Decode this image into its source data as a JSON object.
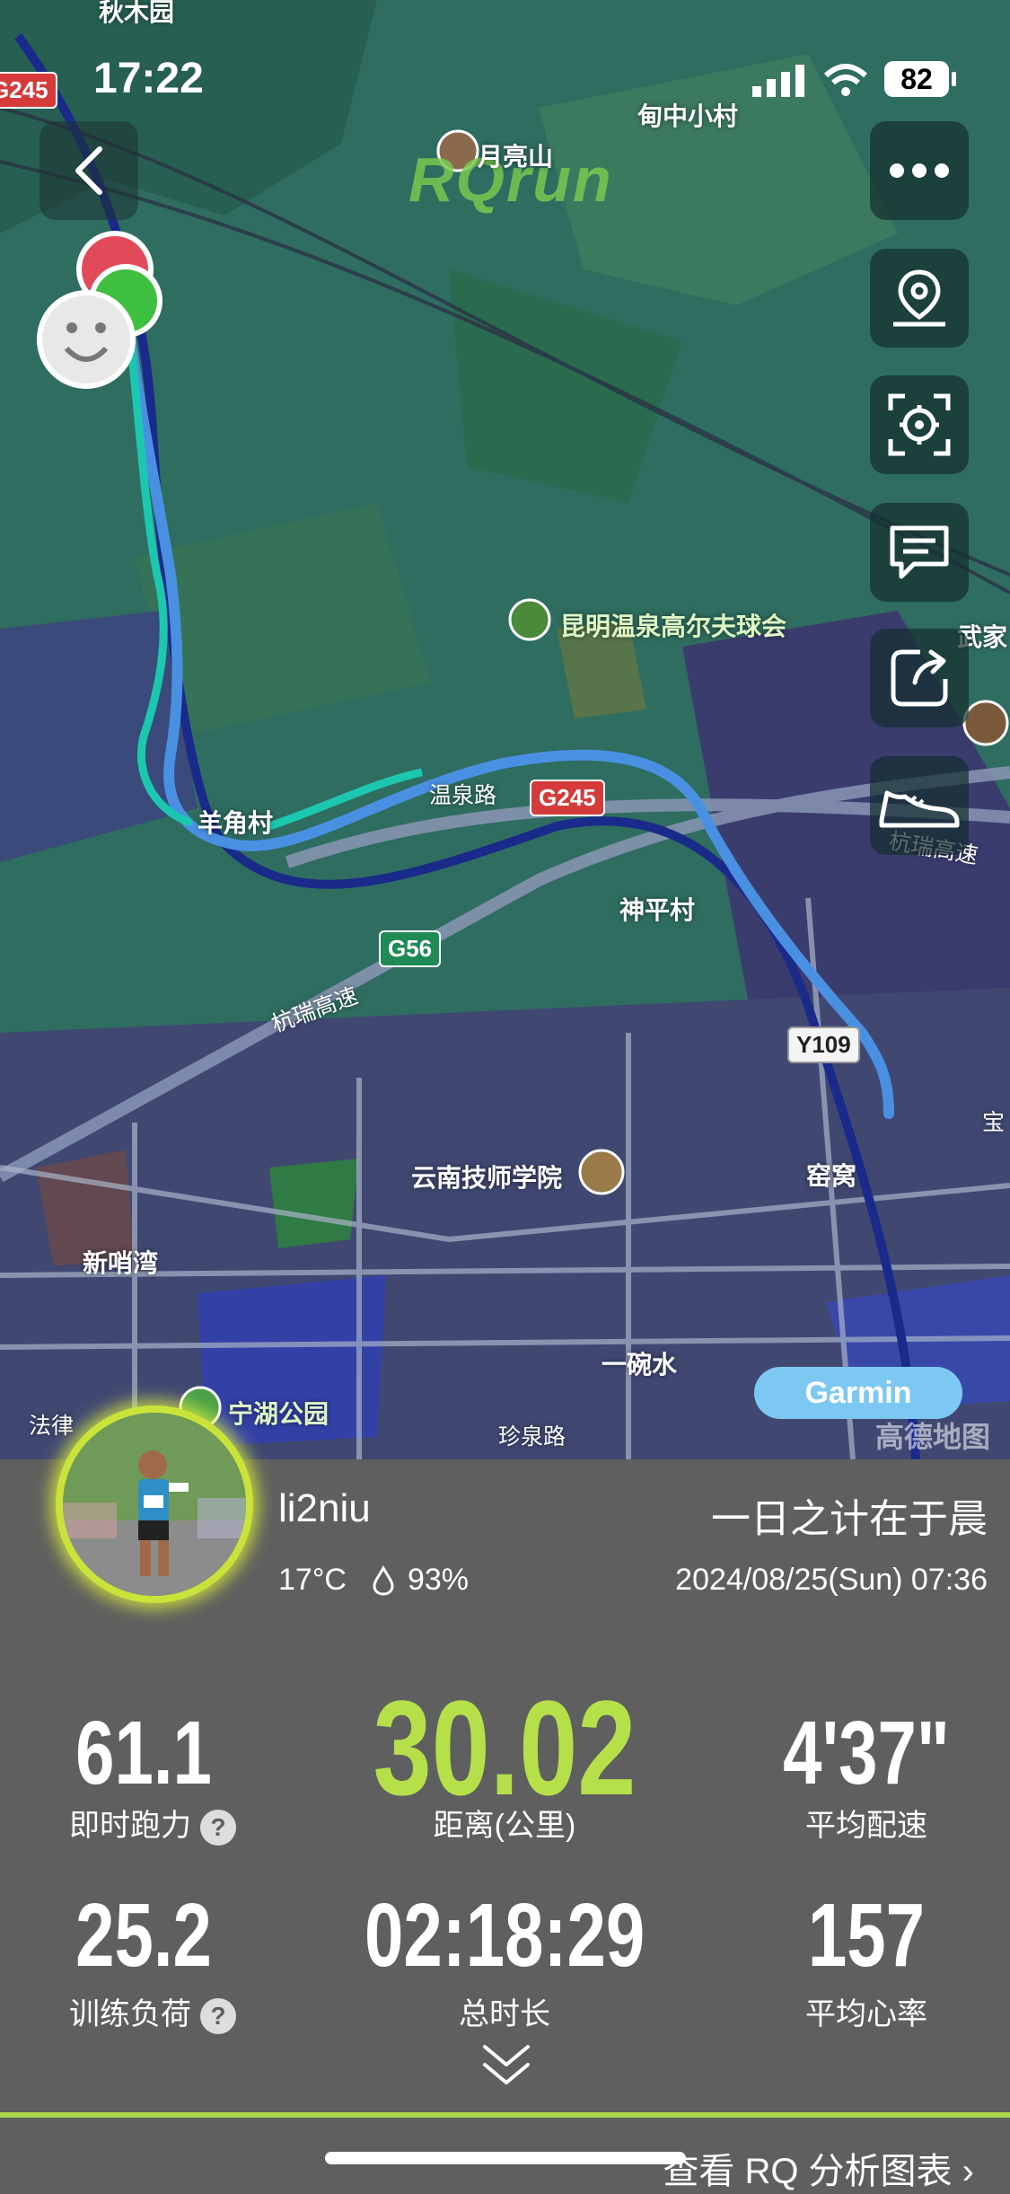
{
  "status_bar": {
    "time": "17:22",
    "battery": "82"
  },
  "map": {
    "watermark": "RQrun",
    "labels": {
      "top_left": "秋木园",
      "village_top": "甸中小村",
      "mountain": "月亮山",
      "golf": "昆明温泉高尔夫球会",
      "wujia": "武家",
      "yangjiao": "羊角村",
      "wenquan_road": "温泉路",
      "shenping": "神平村",
      "hangrui_1": "杭瑞高速",
      "hangrui_2": "杭瑞高速",
      "school": "云南技师学院",
      "yaowo": "窑窝",
      "xinshao": "新哨湾",
      "yiwan": "一碗水",
      "zhenquan": "珍泉路",
      "ninghu": "宁湖公园",
      "falv": "法律",
      "bao": "宝"
    },
    "shields": {
      "g245_top": "G245",
      "g245_mid": "G245",
      "g56": "G56",
      "y109": "Y109"
    },
    "garmin_label": "Garmin",
    "amap_logo": "高德地图"
  },
  "profile": {
    "username": "li2niu",
    "temperature": "17°C",
    "humidity": "93%",
    "motto": "一日之计在于晨",
    "datetime": "2024/08/25(Sun) 07:36"
  },
  "stats": {
    "running_power": {
      "value": "61.1",
      "label": "即时跑力"
    },
    "distance": {
      "value": "30.02",
      "label": "距离(公里)"
    },
    "avg_pace": {
      "value": "4'37\"",
      "label": "平均配速"
    },
    "training_load": {
      "value": "25.2",
      "label": "训练负荷"
    },
    "duration": {
      "value": "02:18:29",
      "label": "总时长"
    },
    "avg_hr": {
      "value": "157",
      "label": "平均心率"
    }
  },
  "help_icon_text": "?",
  "analysis_link": "查看 RQ 分析图表 ›",
  "colors": {
    "accent_green": "#b5e04a",
    "route_blue": "#4a90e2",
    "route_teal": "#1cc7b0"
  },
  "icons": [
    "back-icon",
    "more-icon",
    "location-pin-icon",
    "focus-icon",
    "comment-icon",
    "share-icon",
    "shoe-icon",
    "chevron-down-icon"
  ]
}
